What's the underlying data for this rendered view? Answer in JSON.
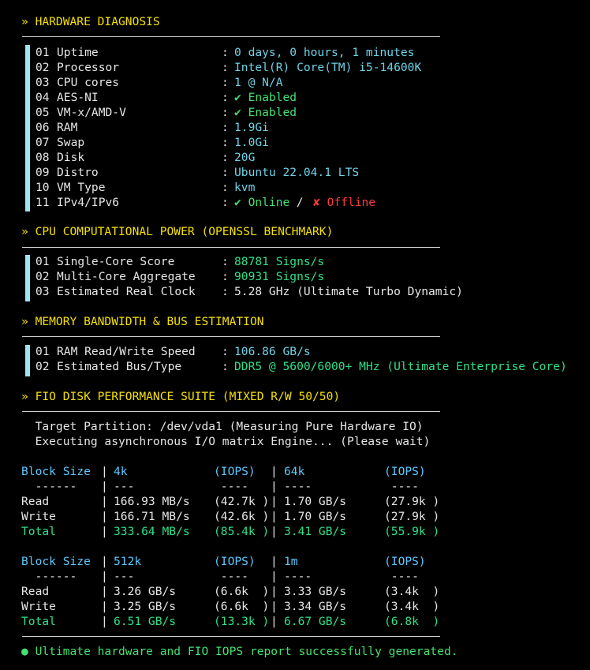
{
  "sections": {
    "hardware_title": "» HARDWARE DIAGNOSIS",
    "cpu_title": "» CPU COMPUTATIONAL POWER (OPENSSL BENCHMARK)",
    "memory_title": "» MEMORY BANDWIDTH & BUS ESTIMATION",
    "fio_title": "» FIO DISK PERFORMANCE SUITE (MIXED R/W 50/50)"
  },
  "hardware": [
    {
      "num": "01",
      "label": "Uptime",
      "value": "0 days, 0 hours, 1 minutes"
    },
    {
      "num": "02",
      "label": "Processor",
      "value": "Intel(R) Core(TM) i5-14600K"
    },
    {
      "num": "03",
      "label": "CPU cores",
      "value": "1 @ N/A"
    },
    {
      "num": "04",
      "label": "AES-NI",
      "value": "✔ Enabled"
    },
    {
      "num": "05",
      "label": "VM-x/AMD-V",
      "value": "✔ Enabled"
    },
    {
      "num": "06",
      "label": "RAM",
      "value": "1.9Gi"
    },
    {
      "num": "07",
      "label": "Swap",
      "value": "1.0Gi"
    },
    {
      "num": "08",
      "label": "Disk",
      "value": "20G"
    },
    {
      "num": "09",
      "label": "Distro",
      "value": "Ubuntu 22.04.1 LTS"
    },
    {
      "num": "10",
      "label": "VM Type",
      "value": "kvm"
    },
    {
      "num": "11",
      "label": "IPv4/IPv6",
      "online": "✔ Online",
      "sep": " / ",
      "offline": "✘ Offline"
    }
  ],
  "cpu": [
    {
      "num": "01",
      "label": "Single-Core Score",
      "value": "88781 Signs/s"
    },
    {
      "num": "02",
      "label": "Multi-Core Aggregate",
      "value": "90931 Signs/s"
    },
    {
      "num": "03",
      "label": "Estimated Real Clock",
      "value": "5.28 GHz (Ultimate Turbo Dynamic)"
    }
  ],
  "memory": [
    {
      "num": "01",
      "label": "RAM Read/Write Speed",
      "value": "106.86 GB/s"
    },
    {
      "num": "02",
      "label": "Estimated Bus/Type",
      "value": "DDR5 @ 5600/6000+ MHz (Ultimate Enterprise Core)"
    }
  ],
  "fio": {
    "target": "  Target Partition: /dev/vda1 (Measuring Pure Hardware IO)",
    "executing": "  Executing asynchronous I/O matrix Engine... (Please wait)",
    "tables": [
      {
        "header": [
          "Block Size",
          "4k",
          "(IOPS)",
          "64k",
          "(IOPS)"
        ],
        "dashes": [
          "  ------",
          "---",
          " ---- ",
          "----",
          " ---- "
        ],
        "rows": [
          [
            "Read",
            "166.93 MB/s",
            "(42.7k )",
            "1.70 GB/s",
            "(27.9k )"
          ],
          [
            "Write",
            "166.71 MB/s",
            "(42.6k )",
            "1.70 GB/s",
            "(27.9k )"
          ],
          [
            "Total",
            "333.64 MB/s",
            "(85.4k )",
            "3.41 GB/s",
            "(55.9k )"
          ]
        ]
      },
      {
        "header": [
          "Block Size",
          "512k",
          "(IOPS)",
          "1m",
          "(IOPS)"
        ],
        "dashes": [
          "  ------",
          "---",
          " ---- ",
          "----",
          " ---- "
        ],
        "rows": [
          [
            "Read",
            "3.26 GB/s",
            "(6.6k  )",
            "3.33 GB/s",
            "(3.4k  )"
          ],
          [
            "Write",
            "3.25 GB/s",
            "(6.6k  )",
            "3.34 GB/s",
            "(3.4k  )"
          ],
          [
            "Total",
            "6.51 GB/s",
            "(13.3k )",
            "6.67 GB/s",
            "(6.8k  )"
          ]
        ]
      }
    ]
  },
  "footer": "● Ultimate hardware and FIO IOPS report successfully generated.",
  "colors": {
    "header": "#f5e000",
    "cyan": "#6fd2e6",
    "green": "#2ee08a",
    "red": "#ff3a3a",
    "blue": "#5cc8ff"
  }
}
